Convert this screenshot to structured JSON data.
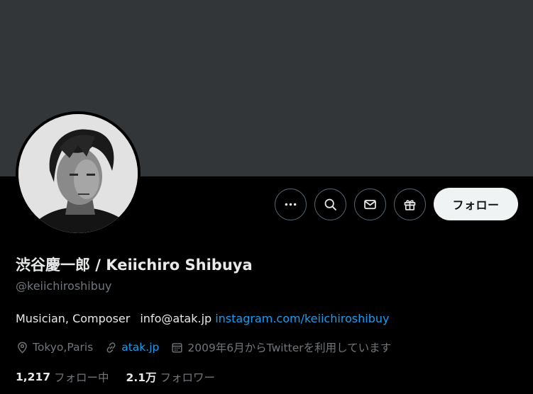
{
  "profile": {
    "display_name": "渋谷慶一郎 / Keiichiro Shibuya",
    "handle": "@keiichiroshibuy",
    "bio_text": "Musician, Composer",
    "bio_email": "info@atak.jp",
    "bio_link": "instagram.com/keiichiroshibuy",
    "location": "Tokyo,Paris",
    "website": "atak.jp",
    "joined": "2009年6月からTwitterを利用しています"
  },
  "actions": {
    "more_icon": "more-icon",
    "search_icon": "search-icon",
    "message_icon": "envelope-icon",
    "gift_icon": "gift-icon",
    "follow_label": "フォロー"
  },
  "stats": {
    "following_count": "1,217",
    "following_label": "フォロー中",
    "followers_count": "2.1万",
    "followers_label": "フォロワー"
  },
  "colors": {
    "background": "#000000",
    "banner": "#333639",
    "link": "#1d9bf0",
    "secondary_text": "#71767b",
    "primary_text": "#e7e9ea",
    "follow_button_bg": "#eff3f4"
  }
}
